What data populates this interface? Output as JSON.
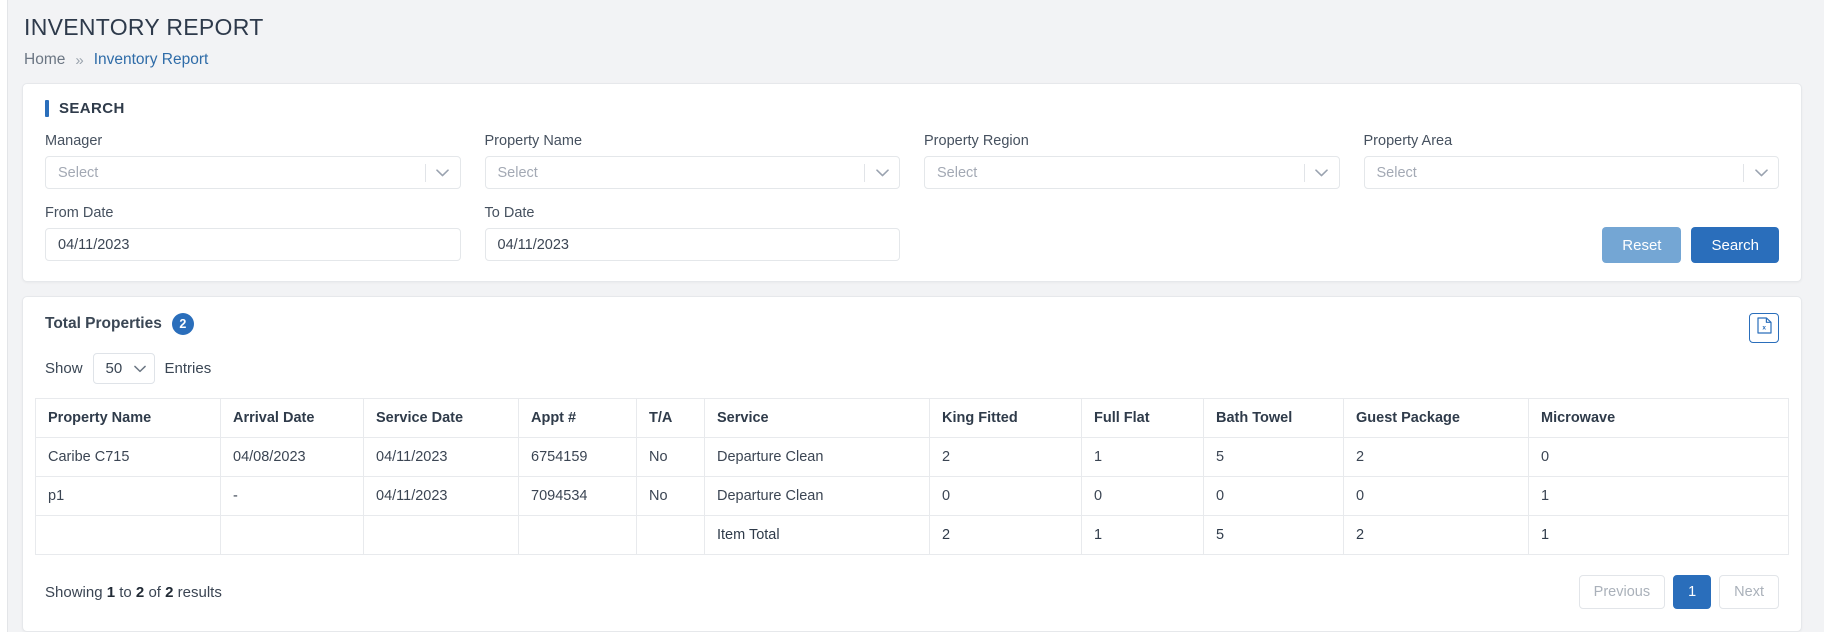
{
  "header": {
    "title": "INVENTORY REPORT",
    "breadcrumb": {
      "home": "Home",
      "separator": "»",
      "current": "Inventory Report"
    }
  },
  "search": {
    "panel_label": "SEARCH",
    "fields": [
      {
        "label": "Manager",
        "value": "Select",
        "type": "select"
      },
      {
        "label": "Property Name",
        "value": "Select",
        "type": "select"
      },
      {
        "label": "Property Region",
        "value": "Select",
        "type": "select"
      },
      {
        "label": "Property Area",
        "value": "Select",
        "type": "select"
      },
      {
        "label": "From Date",
        "value": "04/11/2023",
        "type": "date"
      },
      {
        "label": "To Date",
        "value": "04/11/2023",
        "type": "date"
      }
    ],
    "reset_label": "Reset",
    "search_label": "Search"
  },
  "table_panel": {
    "total_label": "Total Properties",
    "total_count": "2",
    "show_label": "Show",
    "entries_value": "50",
    "entries_label": "Entries",
    "export_icon": "excel-file-icon",
    "columns": [
      "Property Name",
      "Arrival Date",
      "Service Date",
      "Appt #",
      "T/A",
      "Service",
      "King Fitted",
      "Full Flat",
      "Bath Towel",
      "Guest Package",
      "Microwave"
    ],
    "rows": [
      {
        "property_name": "Caribe C715",
        "arrival_date": "04/08/2023",
        "service_date": "04/11/2023",
        "appt": "6754159",
        "ta": "No",
        "service": "Departure Clean",
        "king_fitted": "2",
        "full_flat": "1",
        "bath_towel": "5",
        "guest_package": "2",
        "microwave": "0"
      },
      {
        "property_name": "p1",
        "arrival_date": "-",
        "service_date": "04/11/2023",
        "appt": "7094534",
        "ta": "No",
        "service": "Departure Clean",
        "king_fitted": "0",
        "full_flat": "0",
        "bath_towel": "0",
        "guest_package": "0",
        "microwave": "1"
      }
    ],
    "item_total": {
      "label": "Item Total",
      "king_fitted": "2",
      "full_flat": "1",
      "bath_towel": "5",
      "guest_package": "2",
      "microwave": "1"
    },
    "footer": {
      "showing_prefix": "Showing",
      "showing_from": "1",
      "showing_to_word": "to",
      "showing_to": "2",
      "showing_of_word": "of",
      "showing_total": "2",
      "showing_suffix": "results",
      "previous_label": "Previous",
      "page_label": "1",
      "next_label": "Next"
    }
  },
  "colors": {
    "primary": "#2a6ebb",
    "reset": "#74a6d4",
    "page_bg": "#f2f3f5"
  }
}
